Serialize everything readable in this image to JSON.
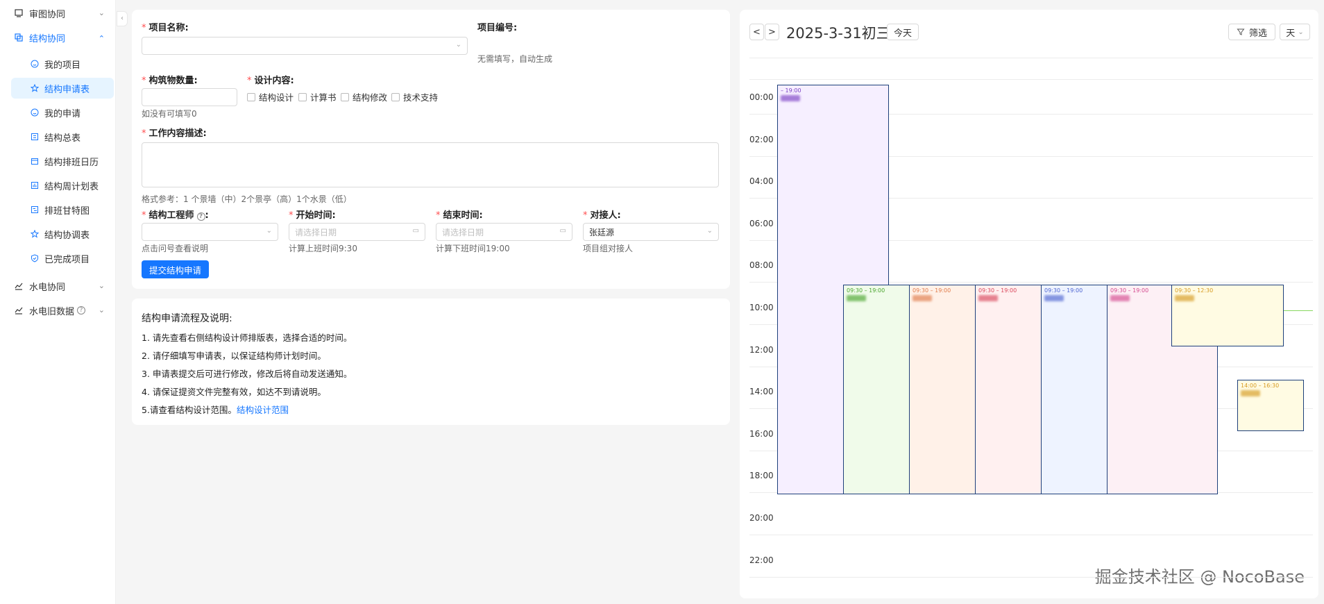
{
  "sidebar": {
    "groups": [
      {
        "label": "审图协同"
      },
      {
        "label": "结构协同"
      },
      {
        "label": "水电协同"
      },
      {
        "label": "水电旧数据"
      }
    ],
    "items": [
      {
        "label": "我的项目"
      },
      {
        "label": "结构申请表"
      },
      {
        "label": "我的申请"
      },
      {
        "label": "结构总表"
      },
      {
        "label": "结构排班日历"
      },
      {
        "label": "结构周计划表"
      },
      {
        "label": "排班甘特图"
      },
      {
        "label": "结构协调表"
      },
      {
        "label": "已完成项目"
      }
    ],
    "collapse_glyph": "‹"
  },
  "form": {
    "project_name": {
      "label": "项目名称:"
    },
    "project_no": {
      "label": "项目编号:",
      "hint": "无需填写，自动生成"
    },
    "building_count": {
      "label": "构筑物数量:",
      "hint": "如没有可填写0"
    },
    "design_content": {
      "label": "设计内容:",
      "options": [
        "结构设计",
        "计算书",
        "结构修改",
        "技术支持"
      ]
    },
    "work_desc": {
      "label": "工作内容描述:",
      "hint": "格式参考：1 个景墙（中）2个景亭（高）1个水景（低）"
    },
    "engineer": {
      "label": "结构工程师",
      "hint": "点击问号查看说明"
    },
    "start_time": {
      "label": "开始时间:",
      "placeholder": "请选择日期",
      "hint": "计算上班时间9:30"
    },
    "end_time": {
      "label": "结束时间:",
      "placeholder": "请选择日期",
      "hint": "计算下班时间19:00"
    },
    "contact": {
      "label": "对接人:",
      "value": "张廷源",
      "hint": "项目组对接人"
    },
    "required_mark": "*",
    "colon": ":",
    "submit_label": "提交结构申请"
  },
  "info": {
    "title": "结构申请流程及说明:",
    "lines": [
      "1. 请先查看右侧结构设计师排版表，选择合适的时间。",
      "2. 请仔细填写申请表，以保证结构师计划时间。",
      "3. 申请表提交后可进行修改，修改后将自动发送通知。",
      "4. 请保证提资文件完整有效，如达不到请说明。",
      "5.请查看结构设计范围。"
    ],
    "link": "结构设计范围"
  },
  "calendar": {
    "prev": "<",
    "next": ">",
    "title": "2025-3-31初三",
    "today": "今天",
    "filter": "筛选",
    "view": "天",
    "hours": [
      "00:00",
      "02:00",
      "04:00",
      "06:00",
      "08:00",
      "10:00",
      "12:00",
      "14:00",
      "16:00",
      "18:00",
      "20:00",
      "22:00"
    ],
    "events": [
      {
        "time": "– 19:00",
        "color": "#7a3fc4",
        "fill": "#f6efff"
      },
      {
        "time": "09:30 – 19:00",
        "color": "#4aa52e",
        "fill": "#f0fbea"
      },
      {
        "time": "09:30 – 19:00",
        "color": "#e07b4a",
        "fill": "#fff1e8"
      },
      {
        "time": "09:30 – 19:00",
        "color": "#d9475c",
        "fill": "#fff0f0"
      },
      {
        "time": "09:30 – 19:00",
        "color": "#4d64d1",
        "fill": "#eef3ff"
      },
      {
        "time": "09:30 – 19:00",
        "color": "#d4488e",
        "fill": "#fdf0f5"
      },
      {
        "time": "09:30 – 12:30",
        "color": "#d69a1f",
        "fill": "#fffbe3"
      },
      {
        "time": "14:00 – 16:30",
        "color": "#d69a1f",
        "fill": "#fffbe3"
      }
    ]
  },
  "watermark": "掘金技术社区 @ NocoBase",
  "icons": {
    "chevron_down": "chevron-down-icon",
    "chevron_up": "chevron-up-icon",
    "calendar": "calendar-icon",
    "filter": "filter-icon",
    "help": "question-circle-icon"
  }
}
